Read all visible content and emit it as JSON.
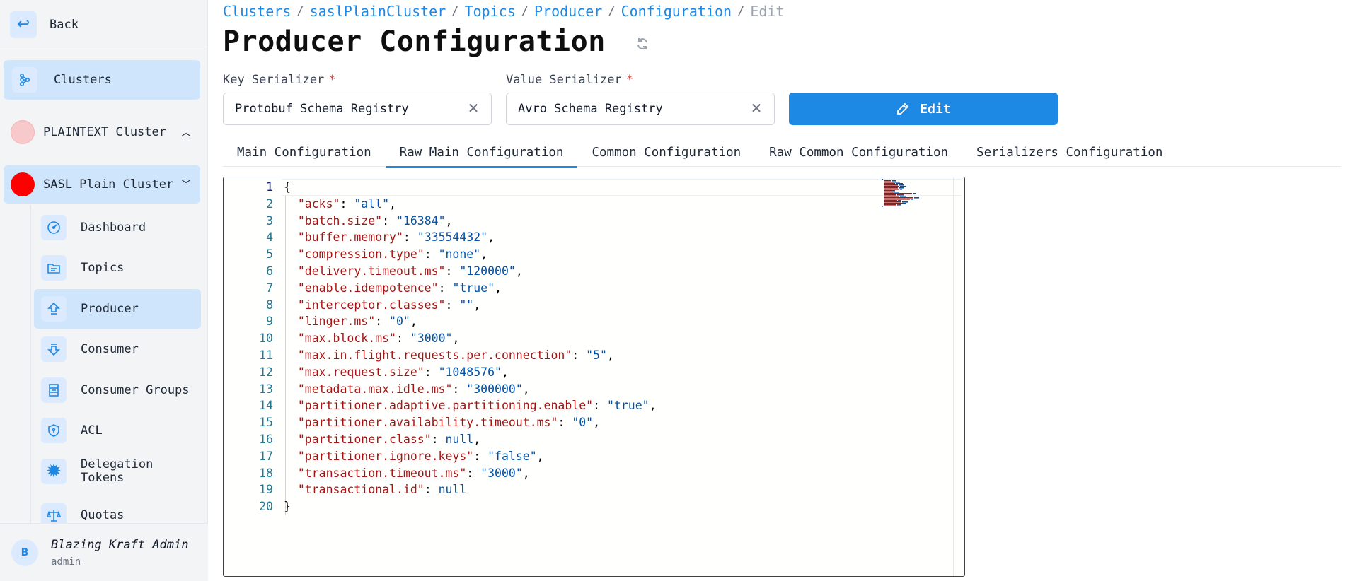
{
  "sidebar": {
    "back_label": "Back",
    "clusters_label": "Clusters",
    "clusters": [
      {
        "label": "PLAINTEXT Cluster",
        "color": "#f8c9cb",
        "expanded": false
      },
      {
        "label": "SASL Plain Cluster",
        "color": "#ff0000",
        "expanded": true
      }
    ],
    "items": [
      {
        "label": "Dashboard",
        "icon": "gauge-icon"
      },
      {
        "label": "Topics",
        "icon": "folder-icon"
      },
      {
        "label": "Producer",
        "icon": "upload-arrow-icon",
        "active": true
      },
      {
        "label": "Consumer",
        "icon": "download-arrow-icon"
      },
      {
        "label": "Consumer Groups",
        "icon": "server-icon"
      },
      {
        "label": "ACL",
        "icon": "shield-icon"
      },
      {
        "label": "Delegation Tokens",
        "icon": "gear-icon"
      },
      {
        "label": "Quotas",
        "icon": "scale-icon"
      }
    ],
    "user": {
      "initial": "B",
      "name": "Blazing Kraft Admin",
      "role": "admin"
    }
  },
  "breadcrumb": [
    "Clusters",
    "saslPlainCluster",
    "Topics",
    "Producer",
    "Configuration",
    "Edit"
  ],
  "page_title": "Producer Configuration",
  "form": {
    "key_label": "Key Serializer",
    "key_value": "Protobuf Schema Registry",
    "value_label": "Value Serializer",
    "value_value": "Avro Schema Registry",
    "required_mark": "*",
    "edit_label": "Edit"
  },
  "tabs": [
    {
      "label": "Main Configuration"
    },
    {
      "label": "Raw Main Configuration",
      "active": true
    },
    {
      "label": "Common Configuration"
    },
    {
      "label": "Raw Common Configuration"
    },
    {
      "label": "Serializers Configuration"
    }
  ],
  "editor": {
    "lines": [
      {
        "t": "{"
      },
      {
        "k": "acks",
        "v": "\"all\"",
        "c": true
      },
      {
        "k": "batch.size",
        "v": "\"16384\"",
        "c": true
      },
      {
        "k": "buffer.memory",
        "v": "\"33554432\"",
        "c": true
      },
      {
        "k": "compression.type",
        "v": "\"none\"",
        "c": true
      },
      {
        "k": "delivery.timeout.ms",
        "v": "\"120000\"",
        "c": true
      },
      {
        "k": "enable.idempotence",
        "v": "\"true\"",
        "c": true
      },
      {
        "k": "interceptor.classes",
        "v": "\"\"",
        "c": true
      },
      {
        "k": "linger.ms",
        "v": "\"0\"",
        "c": true
      },
      {
        "k": "max.block.ms",
        "v": "\"3000\"",
        "c": true
      },
      {
        "k": "max.in.flight.requests.per.connection",
        "v": "\"5\"",
        "c": true
      },
      {
        "k": "max.request.size",
        "v": "\"1048576\"",
        "c": true
      },
      {
        "k": "metadata.max.idle.ms",
        "v": "\"300000\"",
        "c": true
      },
      {
        "k": "partitioner.adaptive.partitioning.enable",
        "v": "\"true\"",
        "c": true
      },
      {
        "k": "partitioner.availability.timeout.ms",
        "v": "\"0\"",
        "c": true
      },
      {
        "k": "partitioner.class",
        "v": "null",
        "c": true
      },
      {
        "k": "partitioner.ignore.keys",
        "v": "\"false\"",
        "c": true
      },
      {
        "k": "transaction.timeout.ms",
        "v": "\"3000\"",
        "c": true
      },
      {
        "k": "transactional.id",
        "v": "null",
        "c": false
      },
      {
        "t": "}"
      }
    ]
  },
  "colors": {
    "accent": "#1e88e5",
    "key_text": "#a31515",
    "value_text": "#0451a5",
    "line_number": "#237893"
  }
}
